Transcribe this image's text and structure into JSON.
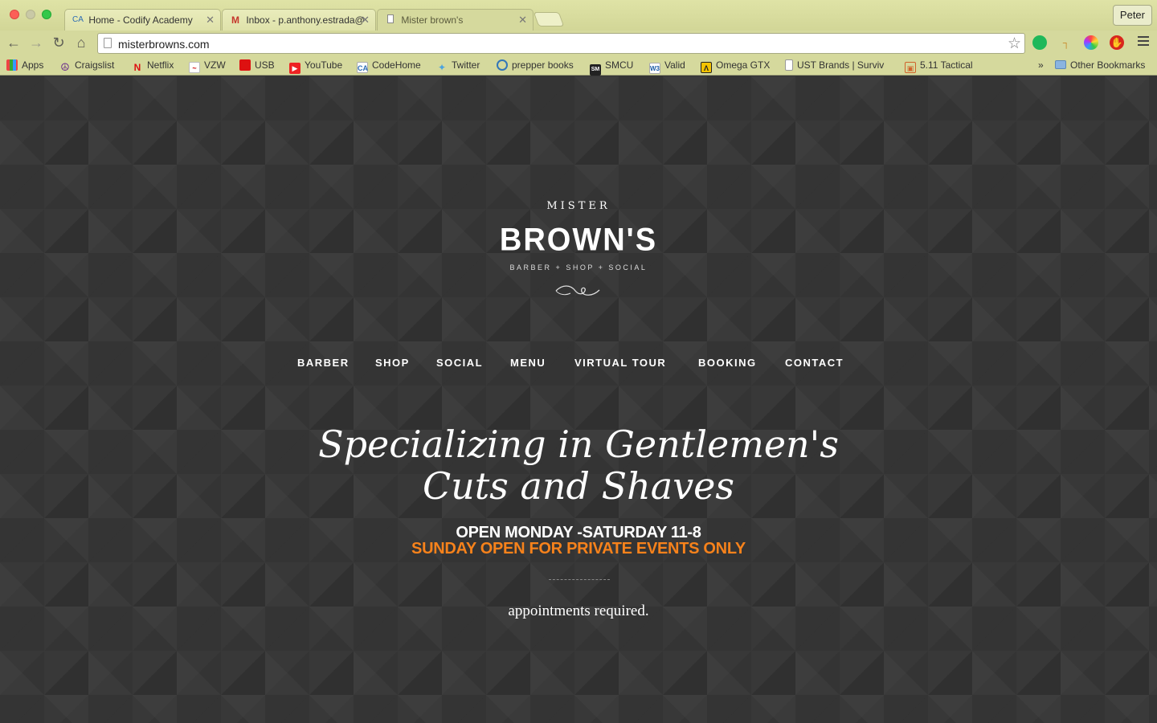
{
  "browser": {
    "tabs": [
      {
        "favicon": "CA",
        "title": "Home - Codify Academy",
        "active": false
      },
      {
        "favicon": "M",
        "title": "Inbox - p.anthony.estrada@",
        "active": false
      },
      {
        "favicon": "page-icon",
        "title": "Mister brown's",
        "active": true
      }
    ],
    "profile_name": "Peter",
    "url": "misterbrowns.com",
    "bookmarks": [
      {
        "label": "Apps",
        "icon": "apps-grid-icon"
      },
      {
        "label": "Craigslist",
        "icon": "peace-icon"
      },
      {
        "label": "Netflix",
        "icon": "netflix-icon"
      },
      {
        "label": "VZW",
        "icon": "vzw-icon"
      },
      {
        "label": "USB",
        "icon": "usb-icon"
      },
      {
        "label": "YouTube",
        "icon": "youtube-icon"
      },
      {
        "label": "CodeHome",
        "icon": "codehome-icon"
      },
      {
        "label": "Twitter",
        "icon": "twitter-icon"
      },
      {
        "label": "prepper books",
        "icon": "globe-icon"
      },
      {
        "label": "SMCU",
        "icon": "smcu-icon"
      },
      {
        "label": "Valid",
        "icon": "w3-icon"
      },
      {
        "label": "Omega GTX",
        "icon": "omega-icon"
      },
      {
        "label": "UST Brands | Surviv",
        "icon": "page-icon"
      },
      {
        "label": "5.11 Tactical",
        "icon": "tactical-icon"
      }
    ],
    "overflow_label": "»",
    "other_bookmarks": "Other Bookmarks"
  },
  "site": {
    "logo_top": "MISTER",
    "logo_main": "BROWN'S",
    "logo_sub": "BARBER + SHOP + SOCIAL",
    "nav": [
      "BARBER",
      "SHOP",
      "SOCIAL",
      "MENU",
      "VIRTUAL TOUR",
      "BOOKING",
      "CONTACT"
    ],
    "headline": "Specializing in Gentlemen's Cuts and Shaves",
    "hours": "OPEN MONDAY -SATURDAY 11-8",
    "sunday": "SUNDAY OPEN FOR PRIVATE EVENTS ONLY",
    "appointments": "appointments required."
  },
  "colors": {
    "chrome": "#d5d99d",
    "page_bg": "#343434",
    "accent_orange": "#f7821b"
  }
}
